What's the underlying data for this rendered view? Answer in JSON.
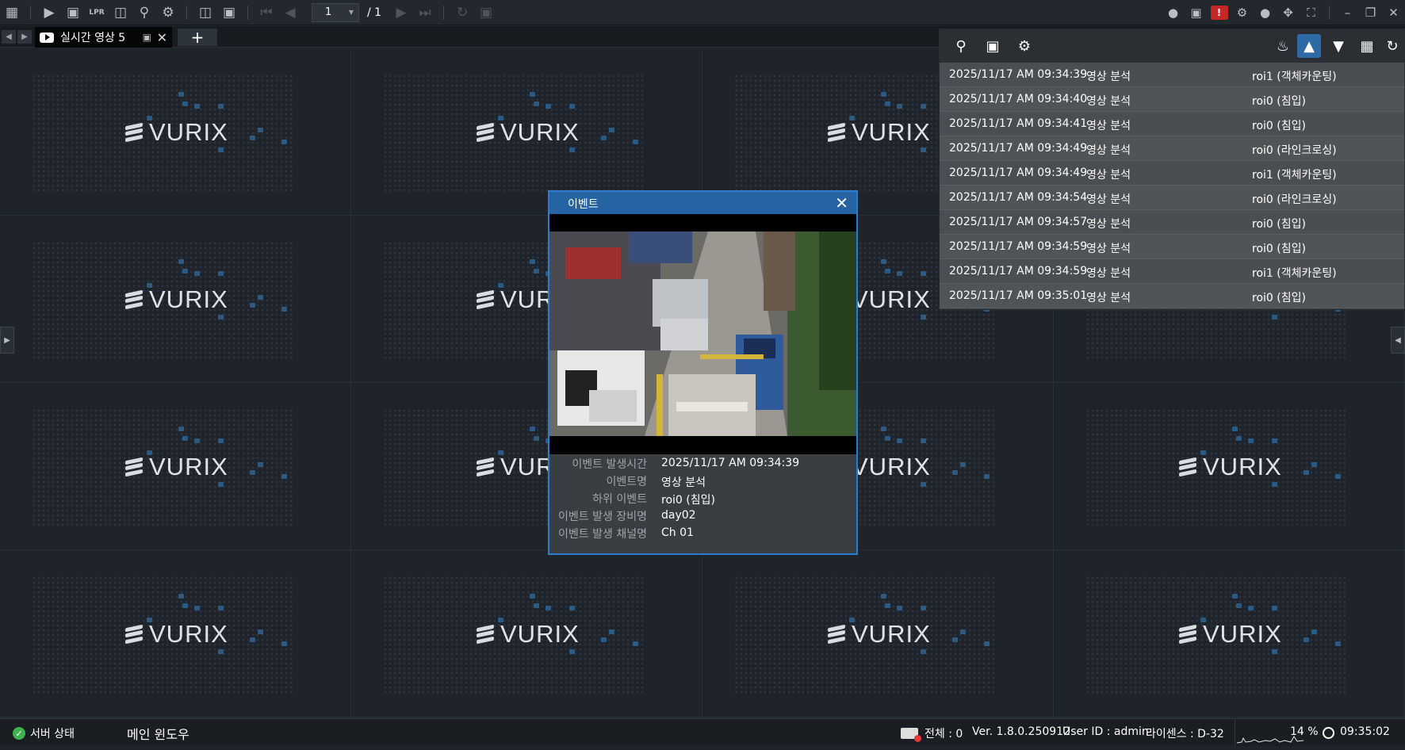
{
  "toolbar": {
    "page_current": "1",
    "page_total": "/ 1",
    "lpr_label": "LPR"
  },
  "tabs": {
    "active_label": "실시간 영상 5",
    "add_label": "+"
  },
  "watermark": {
    "logo_text": "VURIX"
  },
  "event_list": [
    {
      "time": "2025/11/17 AM 09:34:39",
      "name": "영상 분석",
      "sub": "roi1 (객체카운팅)"
    },
    {
      "time": "2025/11/17 AM 09:34:40",
      "name": "영상 분석",
      "sub": "roi0 (침입)"
    },
    {
      "time": "2025/11/17 AM 09:34:41",
      "name": "영상 분석",
      "sub": "roi0 (침입)"
    },
    {
      "time": "2025/11/17 AM 09:34:49",
      "name": "영상 분석",
      "sub": "roi0 (라인크로싱)"
    },
    {
      "time": "2025/11/17 AM 09:34:49",
      "name": "영상 분석",
      "sub": "roi1 (객체카운팅)"
    },
    {
      "time": "2025/11/17 AM 09:34:54",
      "name": "영상 분석",
      "sub": "roi0 (라인크로싱)"
    },
    {
      "time": "2025/11/17 AM 09:34:57",
      "name": "영상 분석",
      "sub": "roi0 (침입)"
    },
    {
      "time": "2025/11/17 AM 09:34:59",
      "name": "영상 분석",
      "sub": "roi0 (침입)"
    },
    {
      "time": "2025/11/17 AM 09:34:59",
      "name": "영상 분석",
      "sub": "roi1 (객체카운팅)"
    },
    {
      "time": "2025/11/17 AM 09:35:01",
      "name": "영상 분석",
      "sub": "roi0 (침입)"
    }
  ],
  "event_dialog": {
    "title": "이벤트",
    "fields": [
      {
        "label": "이벤트 발생시간",
        "value": "2025/11/17 AM 09:34:39"
      },
      {
        "label": "이벤트명",
        "value": "영상 분석"
      },
      {
        "label": "하위 이벤트",
        "value": "roi0 (침입)"
      },
      {
        "label": "이벤트 발생 장비명",
        "value": "day02"
      },
      {
        "label": "이벤트 발생 채널명",
        "value": "Ch 01"
      }
    ]
  },
  "statusbar": {
    "server_status": "서버 상태",
    "main_window": "메인 윈도우",
    "event_total": "전체 : 0",
    "version": "Ver. 1.8.0.250912",
    "user_id": "User ID : admin",
    "license": "라이센스 : D-32",
    "cpu": "14 %",
    "clock": "09:35:02"
  },
  "colors": {
    "accent": "#2563a3",
    "background": "#1f242b",
    "alarm": "#c62828",
    "ok": "#3fb24f"
  }
}
